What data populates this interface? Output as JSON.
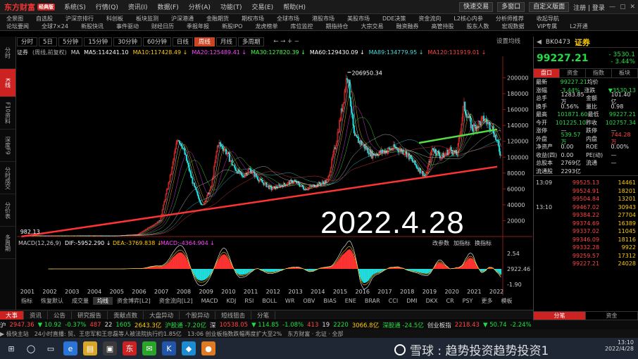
{
  "app": {
    "name": "东方财富",
    "edition": "经典版"
  },
  "menu": [
    "系统(S)",
    "行情(Q)",
    "资讯(I)",
    "数据(F)",
    "分析(A)",
    "功能(T)",
    "交易(E)",
    "帮助(H)"
  ],
  "title_right": {
    "quick_trade": "快速交易",
    "multi_screen": "多窗口",
    "custom_layout": "自定义版面",
    "login": "注册 | 登录"
  },
  "nav1": [
    "全景图",
    "自选股",
    "沪深京排行",
    "科创板",
    "板块监测",
    "沪深港通",
    "金融期货",
    "期权市场",
    "全球市场",
    "港股市场",
    "美股市场",
    "DDE决策",
    "资金流向",
    "L2核心内参",
    "分析师推荐",
    "收起导航"
  ],
  "nav2": [
    "论坛要闻",
    "全球7×24",
    "新股快讯",
    "事件驱动",
    "财经日历",
    "季报年报",
    "新股IPO",
    "龙虎榜单",
    "库位监控",
    "期指持仓",
    "大宗交易",
    "融资融券",
    "高管持股",
    "股东人数",
    "宏观数据",
    "VIP专属",
    "L2开通"
  ],
  "period_tabs": [
    "分时",
    "5日",
    "5分钟",
    "15分钟",
    "30分钟",
    "60分钟",
    "日线",
    "周线",
    "月线",
    "多周期"
  ],
  "period_active": "周线",
  "period_right": "设置均线",
  "side_tabs": [
    "分时",
    "K线",
    "F10资料",
    "深度F9",
    "分时成交",
    "分价表",
    "多周期"
  ],
  "side_active": "K线",
  "ma_line": {
    "name": "证券",
    "adj": "(周线,前复权)",
    "items": [
      {
        "t": "MA",
        "c": "#dddddd"
      },
      {
        "t": "MA5:114241.10",
        "c": "#ffffff"
      },
      {
        "t": "MA10:117428.49 ↓",
        "c": "#ffcc00"
      },
      {
        "t": "MA20:125489.41 ↓",
        "c": "#ff44ff"
      },
      {
        "t": "MA30:127820.39 ↓",
        "c": "#44ff44"
      },
      {
        "t": "MA60:129430.09 ↓",
        "c": "#ffffff"
      },
      {
        "t": "MA89:134779.95 ↓",
        "c": "#44dddd"
      },
      {
        "t": "MA120:131919.01 ↓",
        "c": "#ff4444"
      }
    ]
  },
  "chart_data": [
    {
      "type": "candlestick",
      "ylim": [
        0,
        220000
      ],
      "y_ticks": [
        "200000",
        "180000",
        "160000",
        "140000",
        "120000",
        "100000",
        "80000",
        "60000",
        "40000",
        "20000"
      ],
      "x_ticks": [
        "2001",
        "2002",
        "2003",
        "2004",
        "2005",
        "2006",
        "2007",
        "2008",
        "2009",
        "2010",
        "2011",
        "2012",
        "2013",
        "2014",
        "2015",
        "2016",
        "2017",
        "2018",
        "2019",
        "2020",
        "2021",
        "2022"
      ],
      "annotations": [
        "206950.34",
        "982.13"
      ],
      "close_path": [
        [
          2001,
          1200
        ],
        [
          2002,
          1000
        ],
        [
          2003,
          1050
        ],
        [
          2004,
          1000
        ],
        [
          2005,
          1000
        ],
        [
          2006,
          2500
        ],
        [
          2007,
          20000
        ],
        [
          2007.5,
          80000
        ],
        [
          2007.8,
          125000
        ],
        [
          2008,
          115000
        ],
        [
          2008.5,
          65000
        ],
        [
          2008.9,
          38000
        ],
        [
          2009.3,
          62000
        ],
        [
          2009.6,
          118000
        ],
        [
          2009.9,
          110000
        ],
        [
          2010.3,
          88000
        ],
        [
          2010.7,
          75000
        ],
        [
          2011,
          85000
        ],
        [
          2011.5,
          70000
        ],
        [
          2012,
          60000
        ],
        [
          2012.5,
          65000
        ],
        [
          2013,
          70000
        ],
        [
          2013.5,
          60000
        ],
        [
          2014,
          65000
        ],
        [
          2014.5,
          70000
        ],
        [
          2014.9,
          120000
        ],
        [
          2015.2,
          170000
        ],
        [
          2015.4,
          206950
        ],
        [
          2015.7,
          125000
        ],
        [
          2016,
          118000
        ],
        [
          2016.5,
          103000
        ],
        [
          2017,
          107000
        ],
        [
          2017.5,
          112000
        ],
        [
          2018,
          106000
        ],
        [
          2018.5,
          88000
        ],
        [
          2018.9,
          75000
        ],
        [
          2019.2,
          112000
        ],
        [
          2019.6,
          100000
        ],
        [
          2020,
          110000
        ],
        [
          2020.3,
          103000
        ],
        [
          2020.6,
          165000
        ],
        [
          2021,
          135000
        ],
        [
          2021.5,
          148000
        ],
        [
          2021.9,
          136000
        ],
        [
          2022.3,
          99227
        ]
      ],
      "trendlines": [
        {
          "color": "#ff3333",
          "from": [
            2000.8,
            0
          ],
          "to": [
            2022.1,
            88000
          ]
        },
        {
          "color": "#55dd44",
          "from": [
            2018.6,
            118000
          ],
          "to": [
            2022.1,
            135000
          ]
        }
      ]
    },
    {
      "type": "bar",
      "title": "MACD(12,26,9)",
      "series_text": [
        "DIF:-5952.290 ↓",
        "DEA:-3769.838 ↓",
        "MACD:-4364.904 ↓"
      ],
      "y_ticks": [
        "2.54",
        "2922.46",
        "-1.90"
      ],
      "right_labels": [
        "改参数",
        "加指标",
        "换指标"
      ]
    }
  ],
  "big_date": "2022.4.28",
  "bottom_tabs": [
    "指标",
    "恢复默认",
    "成交量",
    "均线",
    "资金博弈[L2]",
    "资金流向[L2]",
    "MACD",
    "KDJ",
    "RSI",
    "BOLL",
    "WR",
    "OBV",
    "BIAS",
    "ENE",
    "BRAR",
    "CCI",
    "DMI",
    "DKX",
    "CR",
    "PSY",
    "更多",
    "模板"
  ],
  "bottom_active": "均线",
  "info_tabs": [
    "大事",
    "资讯",
    "公告",
    "研究报告",
    "贡献点数",
    "大盘异动",
    "个股异动",
    "短线狙击",
    "分笔"
  ],
  "info_active": "大事",
  "right": {
    "code": "BK0473",
    "name": "证券",
    "price": "99227.21",
    "change": "- 3530.1",
    "pct": "- 3.44%",
    "tabs": [
      "盘口",
      "资金",
      "指数",
      "板块"
    ],
    "quotes": [
      [
        "最新",
        "99227.21",
        "均价",
        ""
      ],
      [
        "涨幅",
        "-3.44%",
        "涨跌",
        "▼3530.13"
      ],
      [
        "总手",
        "1283.85万",
        "金额",
        "101.40亿"
      ],
      [
        "换手",
        "0.56%",
        "量比",
        "0.98"
      ],
      [
        "最高",
        "101871.60",
        "最低",
        "99227.21"
      ],
      [
        "今开",
        "101225.10",
        "昨收",
        "102757.34"
      ],
      [
        "涨停",
        "—",
        "跌停",
        "—"
      ],
      [
        "外盘",
        "539.57万",
        "内盘",
        "744.28万"
      ],
      [
        "净资产",
        "0.00",
        "ROE",
        "0.00%"
      ],
      [
        "收益(四)",
        "0.00",
        "PE(动)",
        "—"
      ],
      [
        "总股本",
        "2769亿",
        "流通",
        "—"
      ],
      [
        "流通股",
        "2293亿",
        "",
        ""
      ]
    ],
    "ticks": [
      [
        "13:09",
        "99525.13",
        "14461"
      ],
      [
        "",
        "99524.91",
        "18201"
      ],
      [
        "",
        "99504.84",
        "13201"
      ],
      [
        "13:10",
        "99467.02",
        "30943"
      ],
      [
        "",
        "99384.22",
        "27704"
      ],
      [
        "",
        "99374.69",
        "16389"
      ],
      [
        "",
        "99337.02",
        "11045"
      ],
      [
        "",
        "99346.09",
        "18116"
      ],
      [
        "",
        "99332.28",
        "9922"
      ],
      [
        "",
        "99259.57",
        "17312"
      ],
      [
        "",
        "99227.21",
        "24028"
      ]
    ],
    "bottom_tabs": [
      "分笔",
      "资金"
    ]
  },
  "index_bar": [
    {
      "t": "沪",
      "c": "#dddddd"
    },
    {
      "t": "2947.36",
      "c": "#ff4444"
    },
    {
      "t": "▼ 10.92",
      "c": "#22dd44"
    },
    {
      "t": "-0.37%",
      "c": "#22dd44"
    },
    {
      "t": "487",
      "c": "#ff4444"
    },
    {
      "t": "22",
      "c": "#dddddd"
    },
    {
      "t": "1605",
      "c": "#22dd44"
    },
    {
      "t": "2643.3亿",
      "c": "#ffcc00"
    },
    {
      "t": "沪股通 -7.20亿",
      "c": "#22dd44"
    },
    {
      "t": "深",
      "c": "#dddddd"
    },
    {
      "t": "10538.05",
      "c": "#ff4444"
    },
    {
      "t": "▼ 114.85",
      "c": "#22dd44"
    },
    {
      "t": "-1.08%",
      "c": "#22dd44"
    },
    {
      "t": "413",
      "c": "#ff4444"
    },
    {
      "t": "19",
      "c": "#dddddd"
    },
    {
      "t": "2220",
      "c": "#22dd44"
    },
    {
      "t": "3066.8亿",
      "c": "#ffcc00"
    },
    {
      "t": "深股通 -24.5亿",
      "c": "#22dd44"
    },
    {
      "t": "创业板指",
      "c": "#dddddd"
    },
    {
      "t": "2218.43",
      "c": "#ff4444"
    },
    {
      "t": "▼ 50.74",
      "c": "#22dd44"
    },
    {
      "t": "-2.24%",
      "c": "#22dd44"
    }
  ],
  "status": [
    "▶ 极快主站",
    "24小时直播: 贸、王忠军和王忠磊等人被法院执行约1.85亿",
    "13:06 创业板指数跌幅再度扩大至2%",
    "东方财富 · 北证 · 全部"
  ],
  "watermark": "雪球 : 趋势投资趋势投资1",
  "clock": {
    "time": "13:10",
    "date": "2022/4/28"
  }
}
